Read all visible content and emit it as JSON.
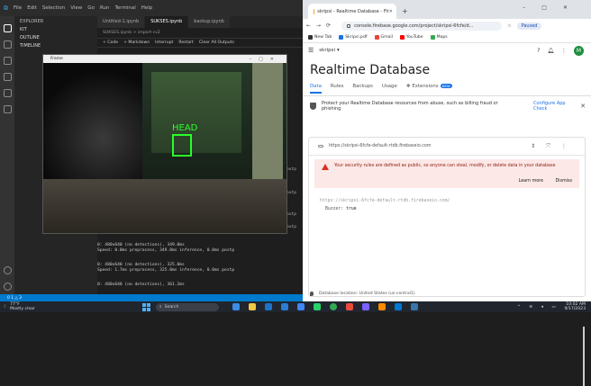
{
  "vscode": {
    "menu": [
      "File",
      "Edit",
      "Selection",
      "View",
      "Go",
      "Run",
      "Terminal",
      "Help"
    ],
    "sidebar": {
      "explorer": "EXPLORER",
      "section": "KIT",
      "outline": "OUTLINE",
      "timeline": "TIMELINE"
    },
    "tabs": [
      "Untitled-1.ipynb",
      "SUKSES.ipynb",
      "backup.ipynb"
    ],
    "breadcrumb": "SUKSES.ipynb > import cv2",
    "toolbar": [
      "+ Code",
      "+ Markdown",
      "Interrupt",
      "Restart",
      "Clear All Outputs"
    ],
    "output_lines": [
      "0: 480x640 (no detections), 349.0ms",
      "Speed: 0.0ms preprocess, 349.0ms inference, 0.0ms postp",
      "0: 480x640 (no detections), 325.0ms",
      "Speed: 1.7ms preprocess, 325.0ms inference, 0.0ms postp",
      "0: 480x640 (no detections), 361.2ms"
    ],
    "output_fragments": [
      "outp",
      "outp",
      "outp",
      "outp"
    ],
    "status": "0 1 △ 3"
  },
  "frame_window": {
    "title": "Frame",
    "label": "HEAD",
    "box_color": "#2aff2a"
  },
  "chrome": {
    "tab_title": "skripsi - Realtime Database - Fir",
    "url": "console.firebase.google.com/project/skripsi-6fcfe/d...",
    "profile": "Paused",
    "bookmarks": [
      "New Tab",
      "Skripsi.pdf",
      "Gmail",
      "YouTube",
      "Maps"
    ]
  },
  "firebase": {
    "project": "skripsi",
    "title": "Realtime Database",
    "tabs": [
      "Data",
      "Rules",
      "Backups",
      "Usage",
      "Extensions"
    ],
    "extensions_badge": "NEW",
    "promo_text": "Protect your Realtime Database resources from abuse, such as billing fraud or phishing",
    "promo_action": "Configure App Check",
    "db_url": "https://skripsi-6fcfe-default-rtdb.firebaseio.com",
    "warning": "Your security rules are defined as public, so anyone can steal, modify, or delete data in your database",
    "learn_more": "Learn more",
    "dismiss": "Dismiss",
    "root": "https://skripsi-6fcfe-default-rtdb.firebaseio.com/",
    "key": "Buzzer:",
    "value": "true",
    "location": "Database location: United States (us-central1)",
    "avatar": "M"
  },
  "taskbar": {
    "temp": "77°F",
    "weather": "Mostly clear",
    "search": "Search",
    "time": "10:02 AM",
    "date": "9/17/2023"
  }
}
